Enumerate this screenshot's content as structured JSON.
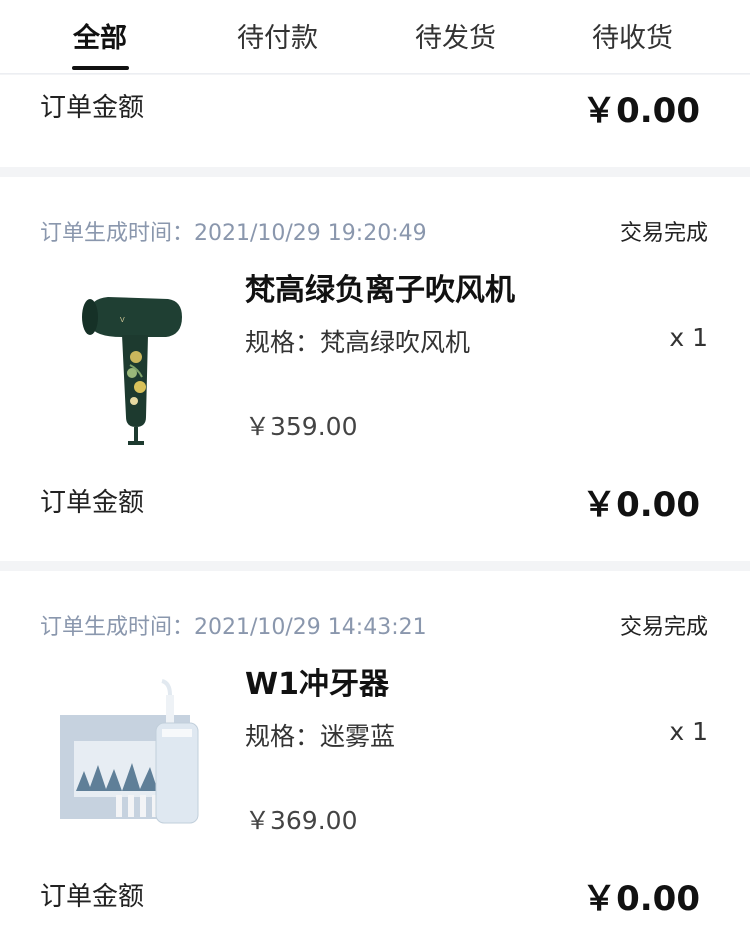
{
  "tabs": [
    {
      "label": "全部",
      "active": true
    },
    {
      "label": "待付款",
      "active": false
    },
    {
      "label": "待发货",
      "active": false
    },
    {
      "label": "待收货",
      "active": false
    }
  ],
  "orders": [
    {
      "amount_label": "订单金额",
      "amount_value": "￥0.00"
    },
    {
      "time_label": "订单生成时间：2021/10/29 19:20:49",
      "status": "交易完成",
      "product_name": "梵高绿负离子吹风机",
      "spec": "规格：梵高绿吹风机",
      "qty": "x 1",
      "price": "￥359.00",
      "amount_label": "订单金额",
      "amount_value": "￥0.00",
      "image_icon": "hair-dryer-icon"
    },
    {
      "time_label": "订单生成时间：2021/10/29 14:43:21",
      "status": "交易完成",
      "product_name": "W1冲牙器",
      "spec": "规格：迷雾蓝",
      "qty": "x 1",
      "price": "￥369.00",
      "amount_label": "订单金额",
      "amount_value": "￥0.00",
      "image_icon": "water-flosser-icon"
    }
  ],
  "colors": {
    "accent": "#111111",
    "meta": "#8a97ad",
    "separator": "#f3f4f6"
  }
}
